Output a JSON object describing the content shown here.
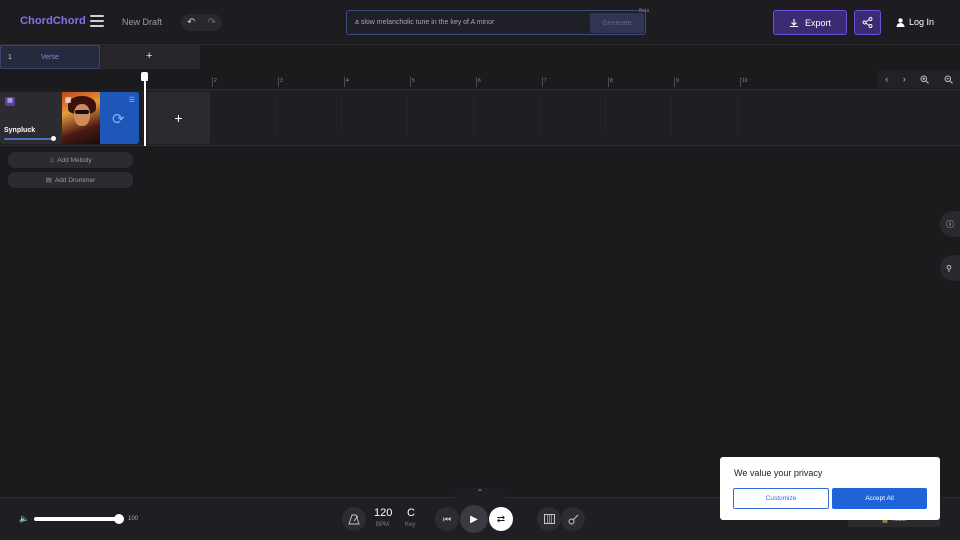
{
  "header": {
    "logo": "ChordChord",
    "draft_name": "New Draft",
    "prompt_text": "a slow melancholic tune in the key of A minor",
    "generate_label": "Generate",
    "beta_label": "Beta",
    "export_label": "Export",
    "login_label": "Log In"
  },
  "sections": {
    "items": [
      {
        "number": "1",
        "name": "Verse"
      }
    ],
    "add_label": "+"
  },
  "ruler": {
    "ticks": [
      "2",
      "3",
      "4",
      "5",
      "6",
      "7",
      "8",
      "9",
      "10"
    ]
  },
  "track": {
    "name": "Synpluck",
    "add_label": "+"
  },
  "add_buttons": {
    "melody": "Add Melody",
    "drummer": "Add Drummer"
  },
  "transport": {
    "volume": "100",
    "volume_level": 1.0,
    "bpm": "120",
    "bpm_label": "BPM",
    "key": "C",
    "key_label": "Key",
    "tools_label": "Tools"
  },
  "cookie": {
    "title": "We value your privacy",
    "customize": "Customize",
    "accept": "Accept All"
  },
  "colors": {
    "accent": "#8b6cf0",
    "export_bg": "#3b2b73",
    "loop_track": "#1f57b8",
    "cookie_accept": "#1e63d8"
  }
}
